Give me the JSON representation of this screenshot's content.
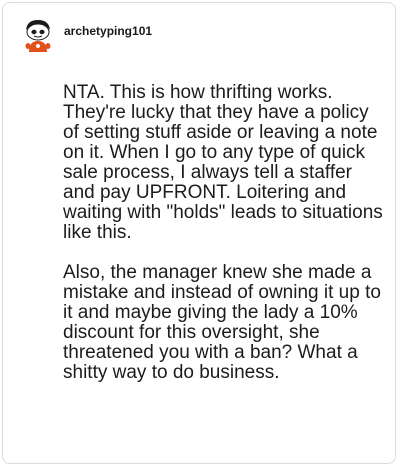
{
  "comment": {
    "username": "archetyping101",
    "avatar_icon": "snoo-avatar-icon",
    "paragraphs": [
      "NTA. This is how thrifting works. They're lucky that they have a policy of setting stuff aside or leaving a note on it. When I go to any type of quick sale process, I always tell a staffer and pay UPFRONT. Loitering and waiting with \"holds\" leads to situations like this.",
      "Also, the manager knew she made a mistake and instead of owning it up to it and maybe giving the lady a 10% discount for this oversight, she threatened you with a ban? What a shitty way to do business."
    ]
  },
  "colors": {
    "text": "#1c1c1c",
    "avatar_accent": "#e2511c",
    "border": "#dcdcdc"
  }
}
